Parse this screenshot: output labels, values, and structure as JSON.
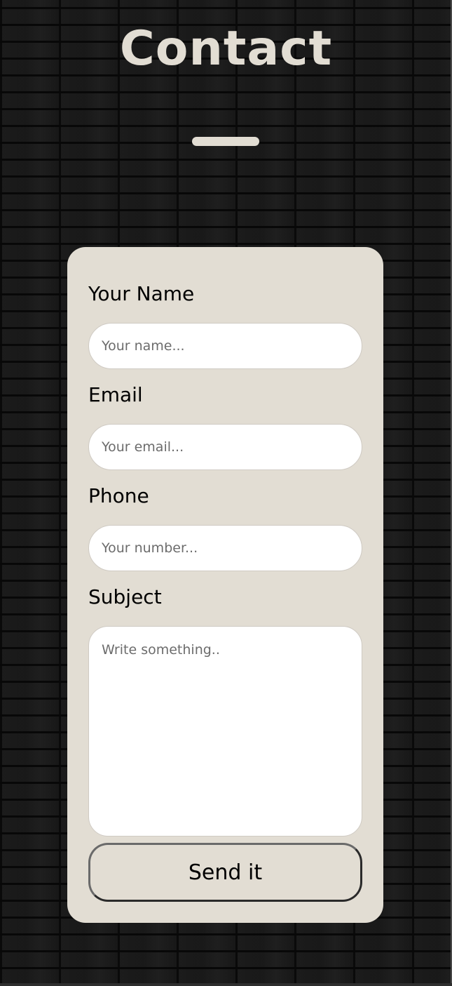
{
  "page": {
    "title": "Contact"
  },
  "form": {
    "name": {
      "label": "Your Name",
      "placeholder": "Your name...",
      "value": ""
    },
    "email": {
      "label": "Email",
      "placeholder": "Your email...",
      "value": ""
    },
    "phone": {
      "label": "Phone",
      "placeholder": "Your number...",
      "value": ""
    },
    "subject": {
      "label": "Subject",
      "placeholder": "Write something..",
      "value": ""
    },
    "submit_label": "Send it"
  },
  "colors": {
    "card_background": "#e2ddd3",
    "title_color": "#e2ddd3",
    "background": "#1e1e1e",
    "text": "#000000"
  }
}
